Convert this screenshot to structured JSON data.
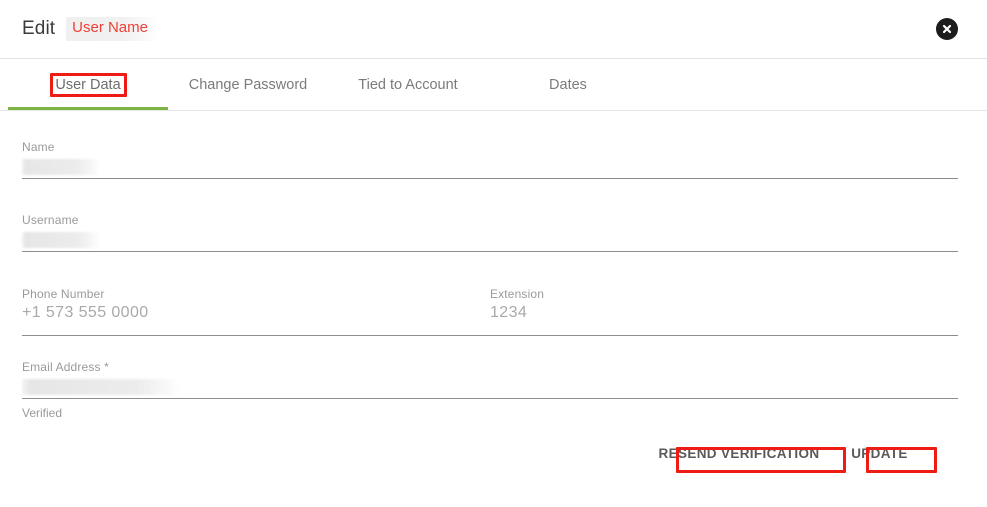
{
  "header": {
    "title": "Edit",
    "badge_label": "User Name",
    "badge_color": "#ef4136",
    "close_icon": "close-circle-icon"
  },
  "tabs": [
    {
      "label": "User Data",
      "active": true,
      "annotated": true
    },
    {
      "label": "Change Password",
      "active": false,
      "annotated": false
    },
    {
      "label": "Tied to Account",
      "active": false,
      "annotated": false
    },
    {
      "label": "Dates",
      "active": false,
      "annotated": false
    }
  ],
  "active_tab_indicator_color": "#7cb342",
  "form": {
    "name": {
      "label": "Name",
      "value": "",
      "redacted": true
    },
    "username": {
      "label": "Username",
      "value": "",
      "redacted": true
    },
    "phone": {
      "label": "Phone Number",
      "value": "",
      "placeholder": "+1 573 555 0000"
    },
    "extension": {
      "label": "Extension",
      "value": "",
      "placeholder": "1234"
    },
    "email": {
      "label": "Email Address *",
      "value": "",
      "redacted": true,
      "helper": "Verified"
    }
  },
  "actions": {
    "resend_label": "RESEND VERIFICATION",
    "update_label": "UPDATE"
  },
  "annotation_color": "#ee1c15"
}
